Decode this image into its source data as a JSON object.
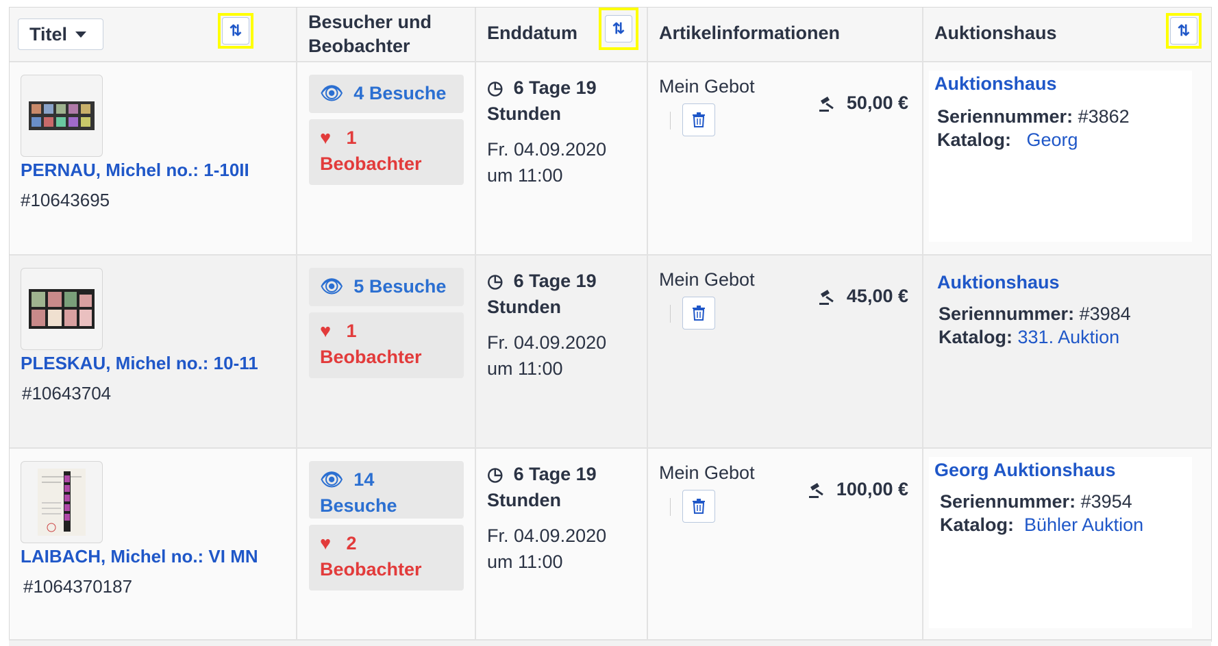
{
  "header": {
    "title_dropdown": "Titel",
    "col_visitors": "Besucher und Beobachter",
    "col_enddate": "Enddatum",
    "col_iteminfo": "Artikelinformationen",
    "col_auction_house": "Auktionshaus"
  },
  "rows": [
    {
      "title": "PERNAU, Michel no.: 1-10II",
      "item_id": "#10643695",
      "visits": "4 Besuche",
      "watchers_count": "1",
      "watchers_label": "Beobachter",
      "end_line1": "6 Tage 19",
      "end_line2": "Stunden",
      "end_date": "Fr. 04.09.2020",
      "end_time": "um 11:00",
      "bid_label": "Mein Gebot",
      "price": "50,00 €",
      "auction_title": "Auktionshaus",
      "serial_label": "Seriennummer:",
      "serial_value": "#3862",
      "catalog_label": "Katalog:",
      "catalog_value": "Georg"
    },
    {
      "title": "PLESKAU, Michel no.: 10-11",
      "item_id": "#10643704",
      "visits": "5 Besuche",
      "watchers_count": "1",
      "watchers_label": "Beobachter",
      "end_line1": "6 Tage 19",
      "end_line2": "Stunden",
      "end_date": "Fr. 04.09.2020",
      "end_time": "um 11:00",
      "bid_label": "Mein Gebot",
      "price": "45,00 €",
      "auction_title": "Auktionshaus",
      "serial_label": "Seriennummer:",
      "serial_value": "#3984",
      "catalog_label": "Katalog:",
      "catalog_value": "331.  Auktion"
    },
    {
      "title": "LAIBACH, Michel no.: VI MN",
      "item_id": "#1064370187",
      "visits_count": "14",
      "visits_label": "Besuche",
      "watchers_count": "2",
      "watchers_label": "Beobachter",
      "end_line1": "6 Tage 19",
      "end_line2": "Stunden",
      "end_date": "Fr. 04.09.2020",
      "end_time": "um 11:00",
      "bid_label": "Mein Gebot",
      "price": "100,00 €",
      "auction_title": "Georg  Auktionshaus",
      "serial_label": "Seriennummer:",
      "serial_value": "#3954",
      "catalog_label": "Katalog:",
      "catalog_value": "Bühler Auktion"
    }
  ],
  "icons": {
    "sort": "sort-arrows-icon",
    "eye": "eye-icon",
    "heart": "heart-icon",
    "clock": "clock-icon",
    "trash": "trash-icon",
    "gavel": "gavel-icon"
  },
  "colors": {
    "link_blue": "#1f57c8",
    "watch_red": "#e23b3b",
    "highlight": "#ffff00"
  }
}
